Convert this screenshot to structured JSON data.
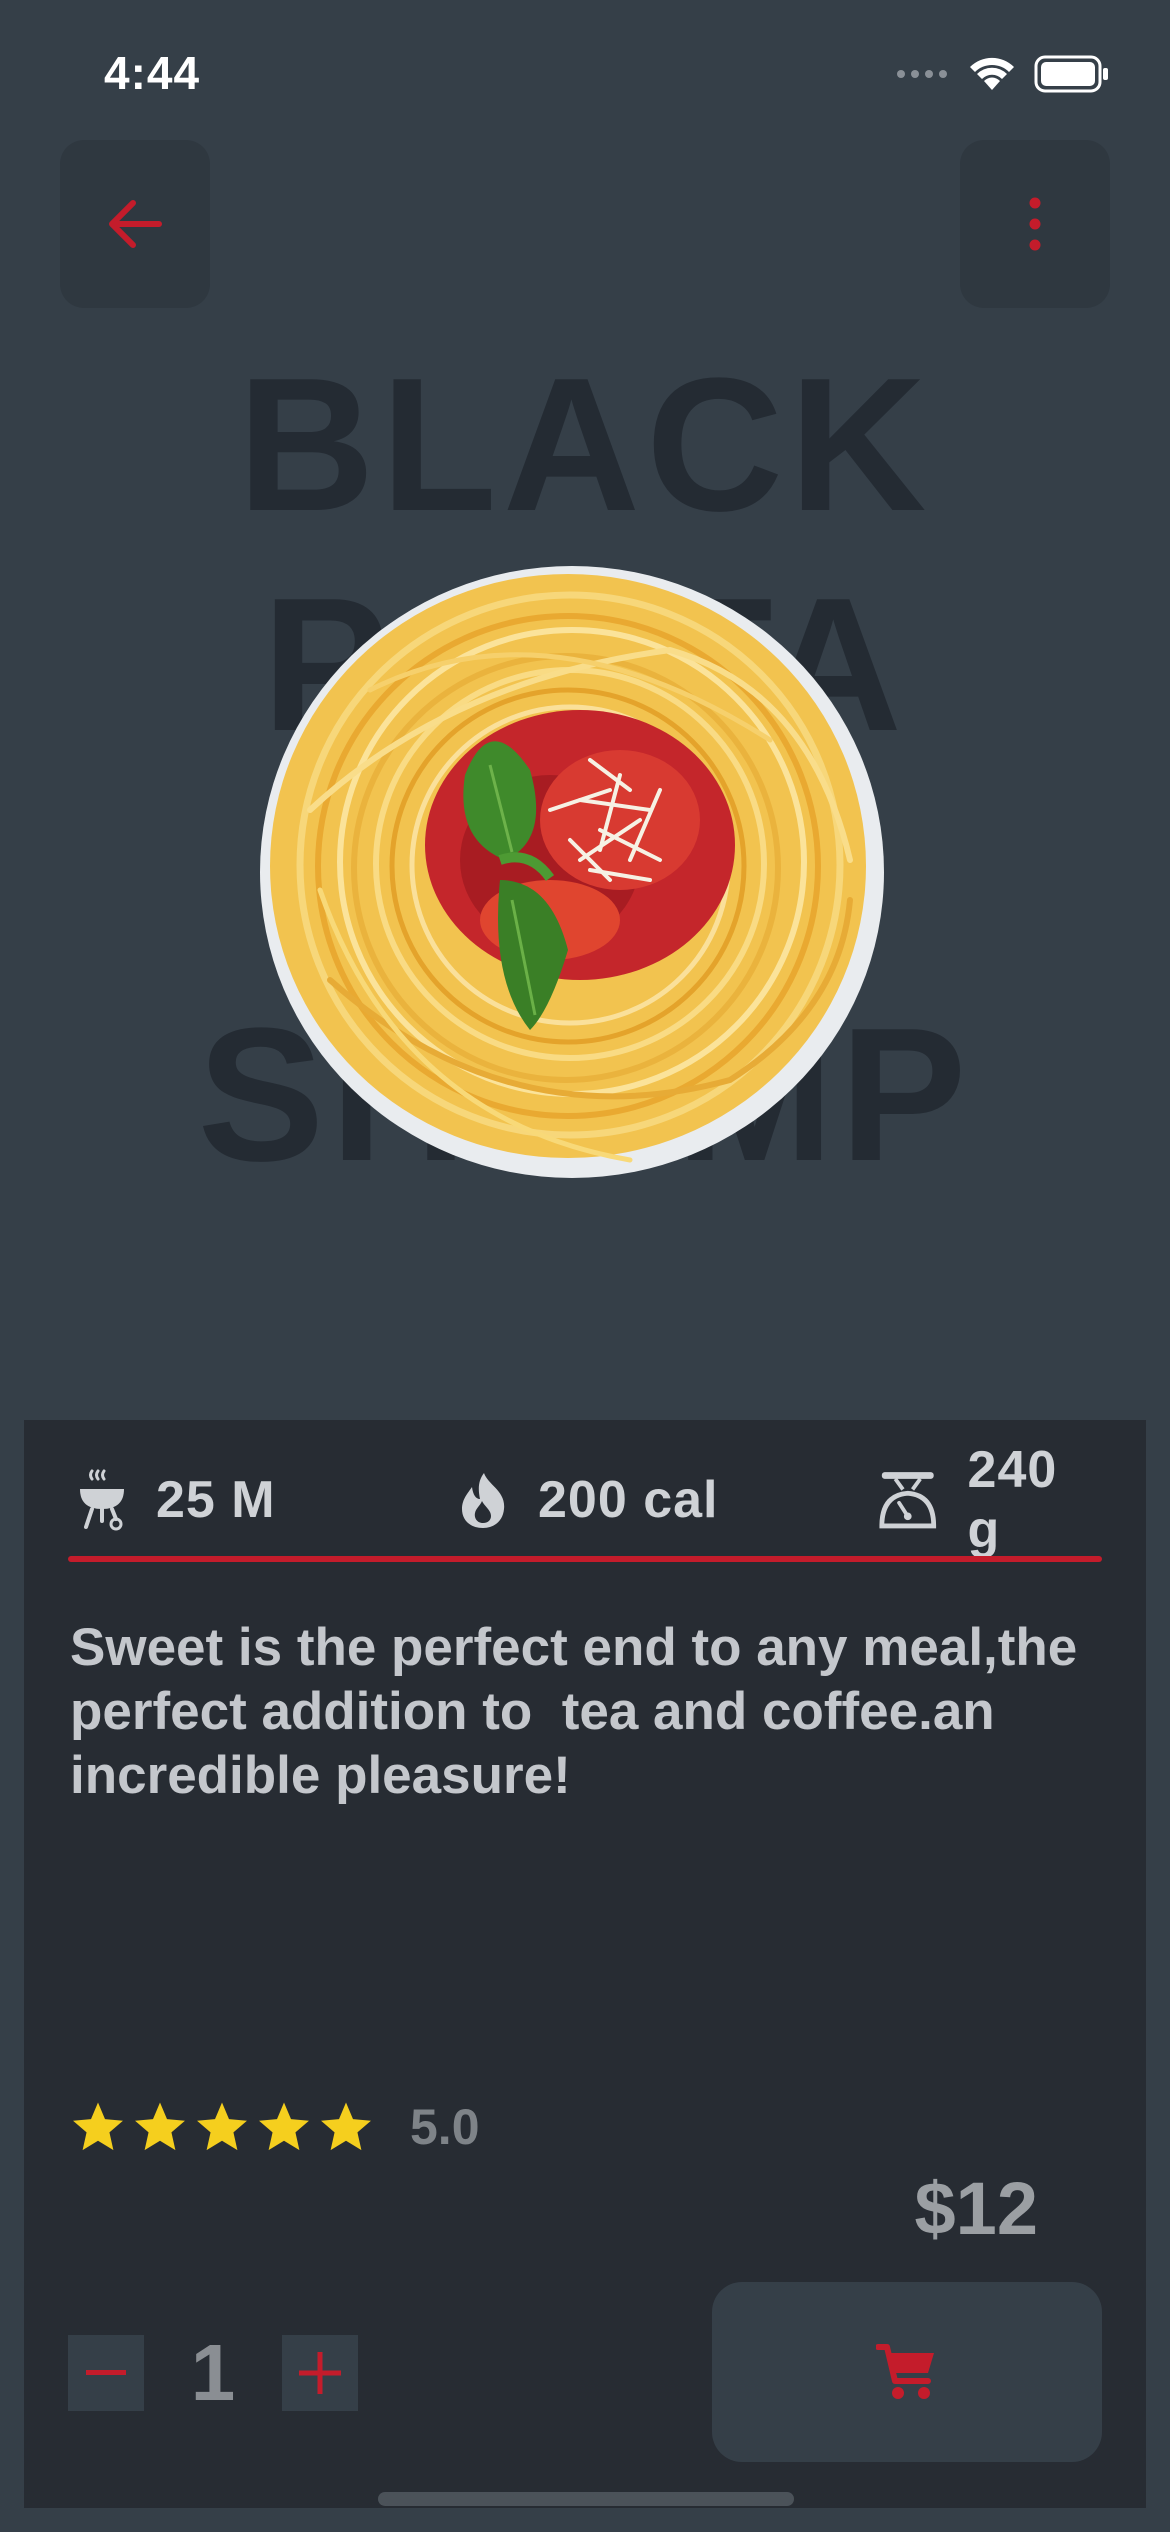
{
  "status_bar": {
    "time": "4:44",
    "icons": [
      "signal-icon",
      "wifi-icon",
      "battery-icon"
    ]
  },
  "nav": {
    "back_icon": "arrow-left-icon",
    "menu_icon": "more-vertical-icon"
  },
  "background_title": {
    "line1": "BLACK",
    "line2": "PASTA",
    "line3": "SHRIMP"
  },
  "stats": {
    "time": {
      "icon": "grill-icon",
      "value": "25 M"
    },
    "calories": {
      "icon": "flame-icon",
      "value": "200 cal"
    },
    "weight": {
      "icon": "scale-icon",
      "value": "240 g"
    }
  },
  "description": "Sweet is the perfect end to any meal,the perfect addition to  tea and coffee.an incredible pleasure!",
  "rating": {
    "stars": 5,
    "value": "5.0"
  },
  "price": "$12",
  "quantity": {
    "value": "1",
    "minus_icon": "minus-icon",
    "plus_icon": "plus-icon"
  },
  "cart": {
    "icon": "cart-icon"
  },
  "colors": {
    "accent": "#c41c2b",
    "background": "#353f48",
    "card": "#272c33",
    "star": "#f5cf1e"
  }
}
